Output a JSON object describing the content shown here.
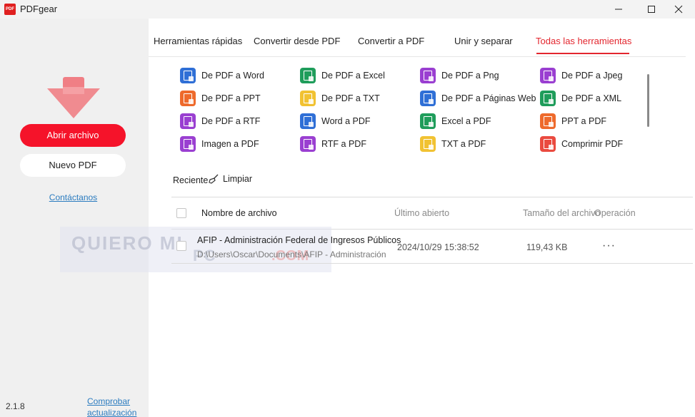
{
  "app": {
    "title": "PDFgear",
    "logo_text": "PDF"
  },
  "sidebar": {
    "open_button": "Abrir archivo",
    "new_button": "Nuevo PDF",
    "contact_link": "Contáctanos",
    "version": "2.1.8",
    "update_link": "Comprobar actualización"
  },
  "tabs": [
    {
      "label": "Herramientas rápidas"
    },
    {
      "label": "Convertir desde PDF"
    },
    {
      "label": "Convertir a PDF"
    },
    {
      "label": "Unir y separar"
    },
    {
      "label": "Todas las herramientas"
    }
  ],
  "active_tab": "Todas las herramientas",
  "tools": [
    {
      "label": "De PDF a Word",
      "color": "#2f6fd6"
    },
    {
      "label": "De PDF a Excel",
      "color": "#1f9d5b"
    },
    {
      "label": "De PDF a Png",
      "color": "#9a3fd1"
    },
    {
      "label": "De PDF a Jpeg",
      "color": "#9a3fd1"
    },
    {
      "label": "De PDF a PPT",
      "color": "#ee6a2c"
    },
    {
      "label": "De PDF a TXT",
      "color": "#f1c232"
    },
    {
      "label": "De PDF a Páginas Web",
      "color": "#2f6fd6"
    },
    {
      "label": "De PDF a XML",
      "color": "#1f9d5b"
    },
    {
      "label": "De PDF a RTF",
      "color": "#9a3fd1"
    },
    {
      "label": "Word a PDF",
      "color": "#2f6fd6"
    },
    {
      "label": "Excel a PDF",
      "color": "#1f9d5b"
    },
    {
      "label": "PPT a PDF",
      "color": "#ee6a2c"
    },
    {
      "label": "Imagen a PDF",
      "color": "#9a3fd1"
    },
    {
      "label": "RTF a PDF",
      "color": "#9a3fd1"
    },
    {
      "label": "TXT a PDF",
      "color": "#f1c232"
    },
    {
      "label": "Comprimir PDF",
      "color": "#ea4a3f"
    }
  ],
  "recent": {
    "label": "Reciente",
    "clean_label": "Limpiar",
    "columns": {
      "name": "Nombre de archivo",
      "opened": "Último abierto",
      "size": "Tamaño del archivo",
      "operation": "Operación"
    },
    "rows": [
      {
        "name": "AFIP - Administración Federal de Ingresos Públicos",
        "path": "D:\\Users\\Oscar\\Documents\\AFIP - Administración Federal de Ingresos Públicos.pdf",
        "opened": "2024/10/29 15:38:52",
        "size": "119,43 KB",
        "menu": "···"
      }
    ]
  },
  "watermark": {
    "line1": "QUIERO MI",
    "line2": "PC",
    "line3": ".COM"
  },
  "colors": {
    "accent": "#e3262e",
    "open_button": "#f5132a",
    "link": "#2a7bbf"
  }
}
